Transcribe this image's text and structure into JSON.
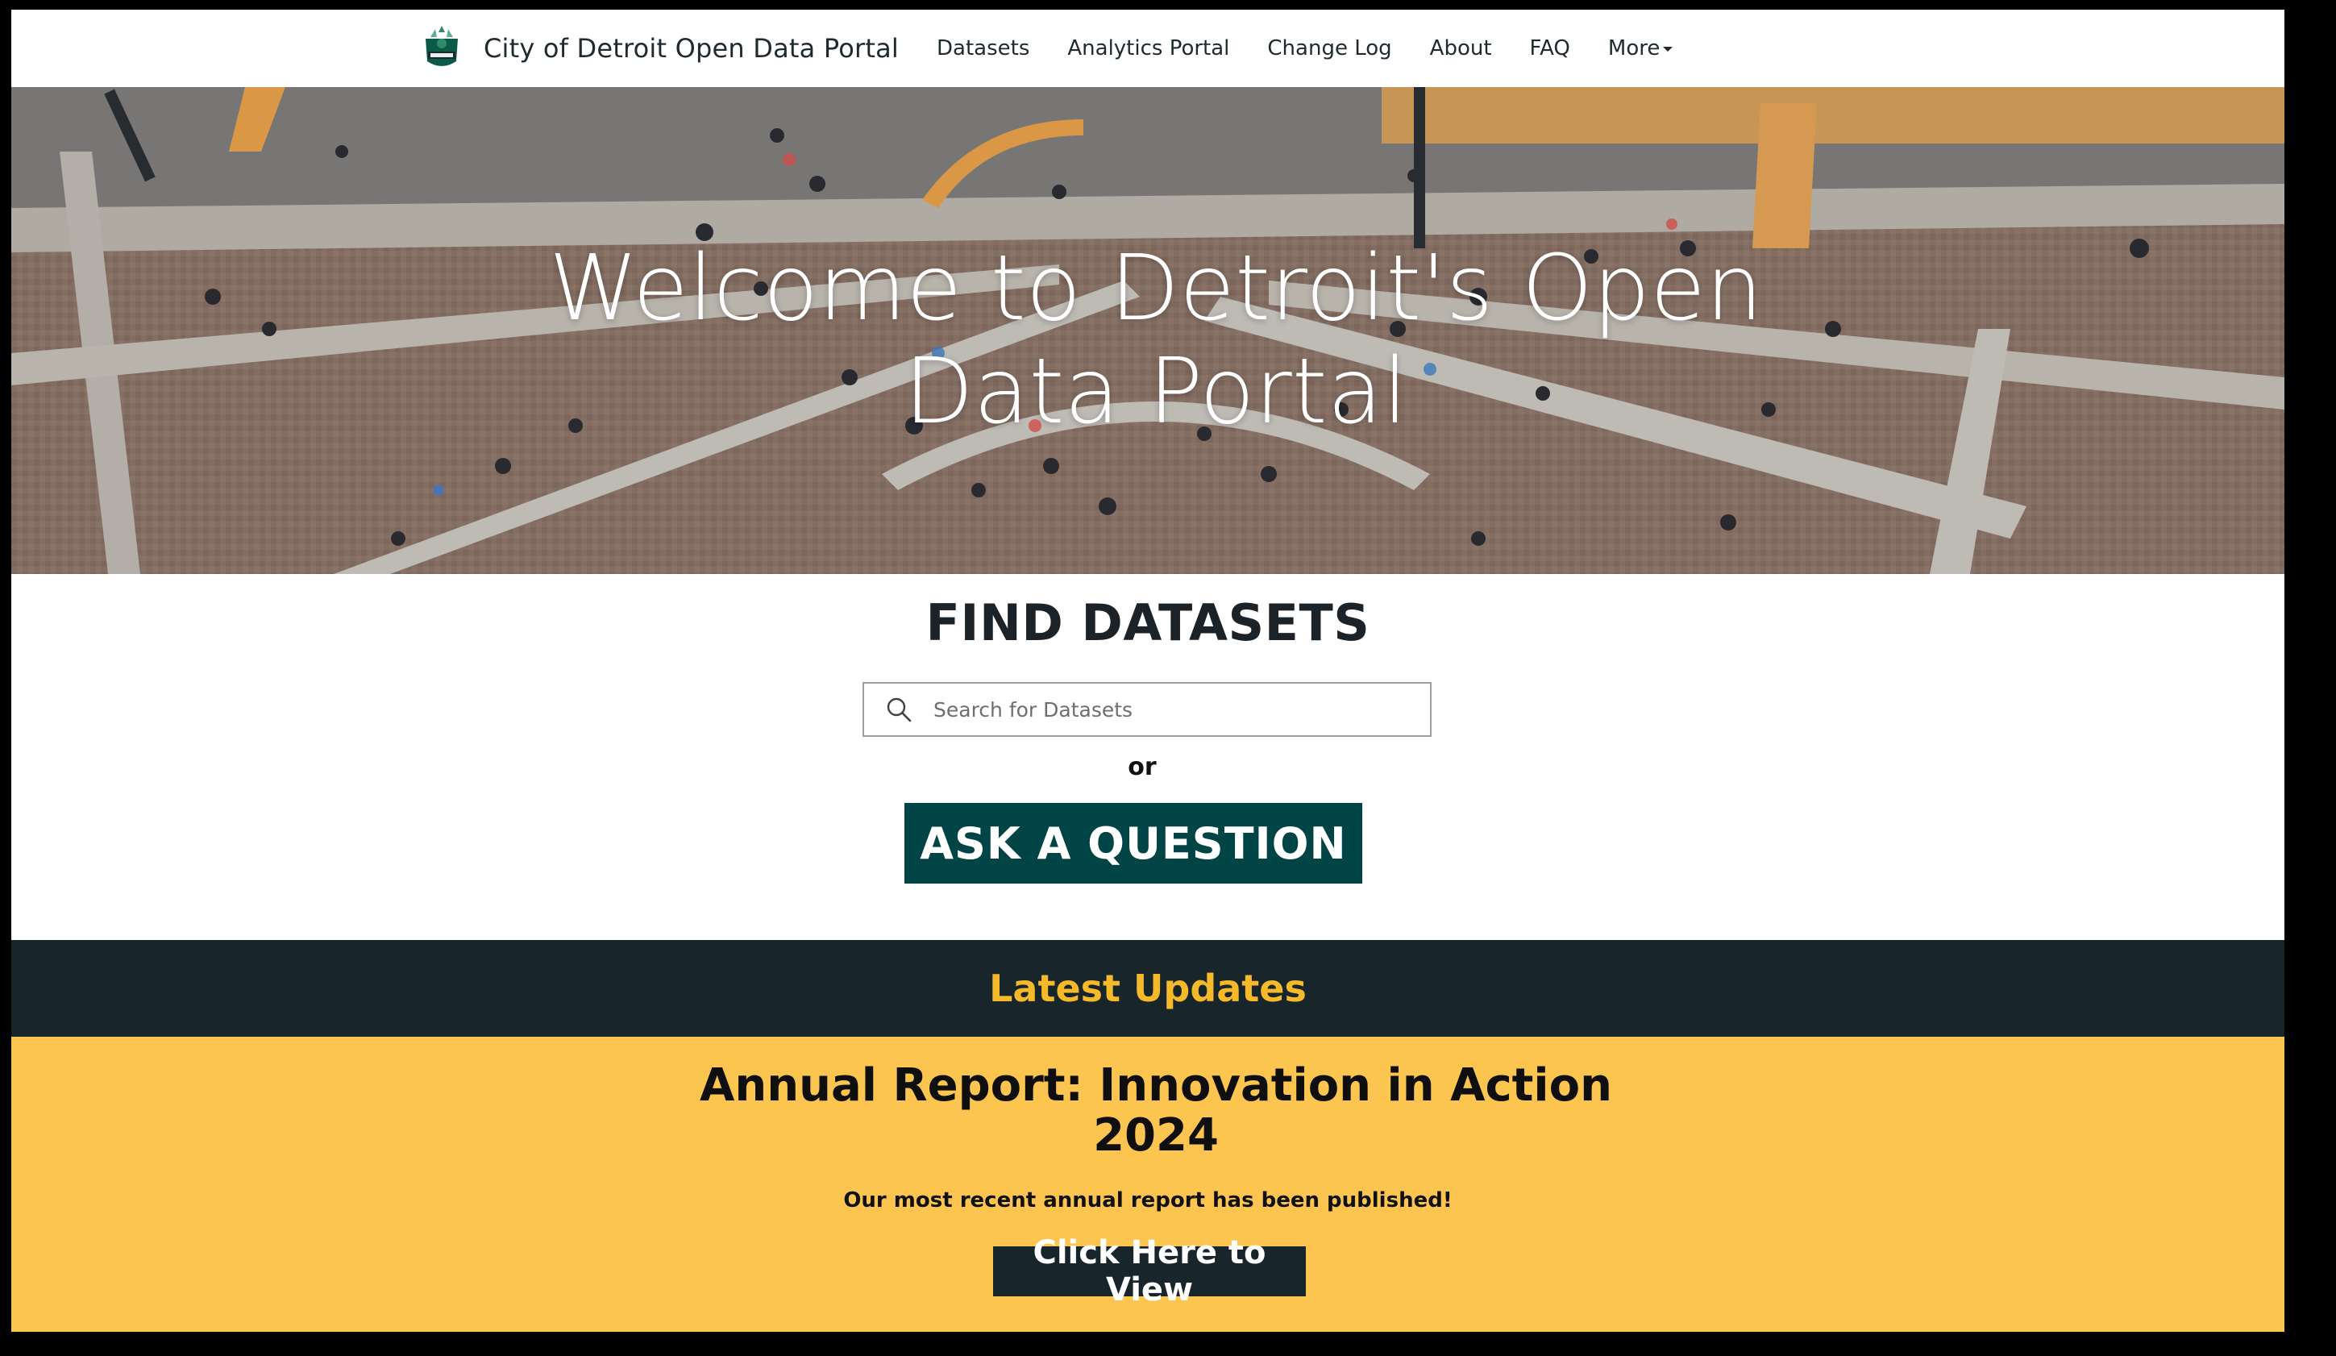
{
  "nav": {
    "brand_title": "City of Detroit Open Data Portal",
    "logo_icon": "detroit-city-seal-icon",
    "links": [
      "Datasets",
      "Analytics Portal",
      "Change Log",
      "About",
      "FAQ"
    ],
    "more_label": "More"
  },
  "hero": {
    "title": "Welcome to Detroit's Open Data Portal",
    "background": "aerial-crowd-plaza-photo"
  },
  "find": {
    "title": "FIND DATASETS",
    "search_placeholder": "Search for Datasets",
    "or_text": "or",
    "ask_label": "ASK A QUESTION"
  },
  "updates": {
    "title": "Latest Updates",
    "report_title": "Annual Report: Innovation in Action 2024",
    "report_subtitle": "Our most recent annual report has been published!",
    "view_label": "Click Here to View"
  },
  "colors": {
    "ask_button": "#004445",
    "updates_bar": "#18252a",
    "updates_title": "#f5b92a",
    "updates_panel": "#fbc550"
  }
}
